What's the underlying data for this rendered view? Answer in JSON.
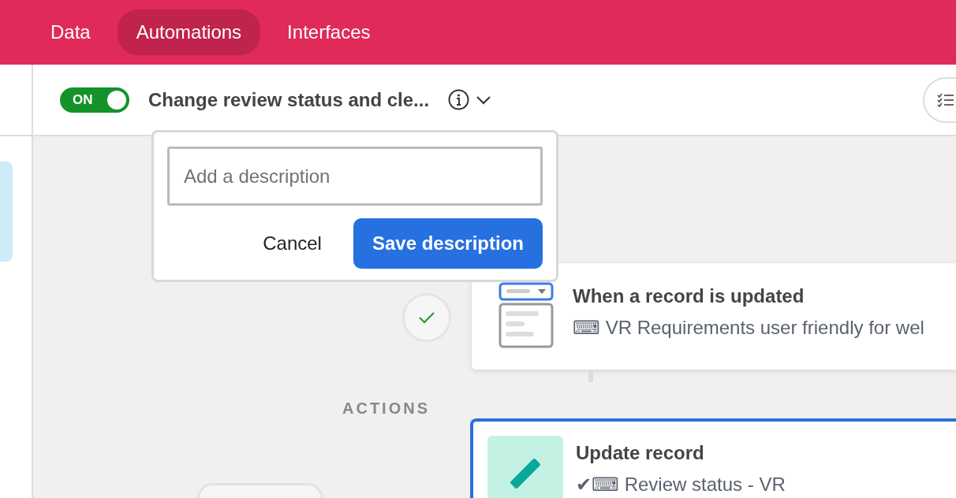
{
  "top_tabs": [
    {
      "label": "Data",
      "selected": false
    },
    {
      "label": "Automations",
      "selected": true
    },
    {
      "label": "Interfaces",
      "selected": false
    }
  ],
  "automation": {
    "on": true,
    "toggle_label": "ON",
    "title": "Change review status and cle..."
  },
  "description_popover": {
    "placeholder": "Add a description",
    "cancel": "Cancel",
    "save": "Save description"
  },
  "trigger": {
    "title": "When a record is updated",
    "subtitle": "⌨ VR Requirements user friendly for wel",
    "done": true
  },
  "actions_label": "ACTIONS",
  "action": {
    "title": "Update record",
    "subtitle": "✔⌨ Review status - VR",
    "selected": true
  }
}
